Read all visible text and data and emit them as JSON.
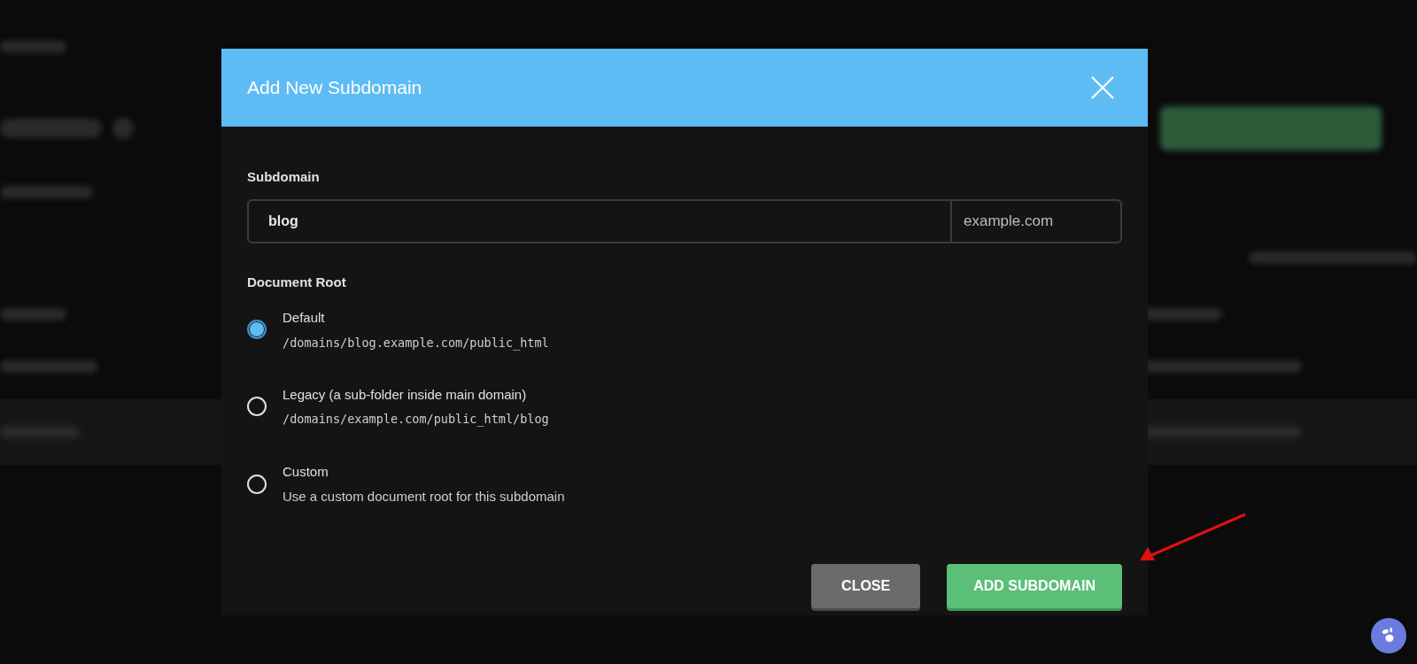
{
  "dialog": {
    "title": "Add New Subdomain",
    "subdomain_label": "Subdomain",
    "subdomain_input": {
      "value": "blog",
      "suffix": "example.com"
    },
    "document_root_label": "Document Root",
    "options": [
      {
        "label": "Default",
        "detail": "/domains/blog.example.com/public_html",
        "kind": "path",
        "selected": true
      },
      {
        "label": "Legacy (a sub-folder inside main domain)",
        "detail": "/domains/example.com/public_html/blog",
        "kind": "path",
        "selected": false
      },
      {
        "label": "Custom",
        "detail": "Use a custom document root for this subdomain",
        "kind": "description",
        "selected": false
      }
    ],
    "buttons": [
      {
        "label": "CLOSE",
        "kind": "secondary"
      },
      {
        "label": "ADD SUBDOMAIN",
        "kind": "primary"
      }
    ]
  }
}
